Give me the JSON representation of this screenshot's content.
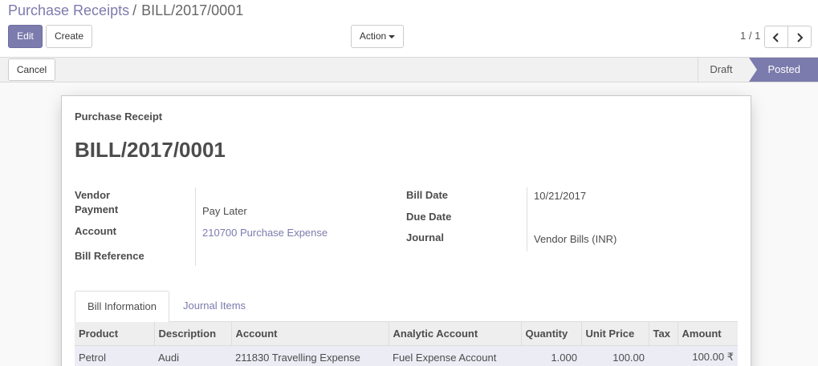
{
  "breadcrumb": {
    "parent": "Purchase Receipts",
    "separator": "/",
    "current": "BILL/2017/0001"
  },
  "toolbar": {
    "edit_label": "Edit",
    "create_label": "Create",
    "action_label": "Action"
  },
  "pager": {
    "value": "1 / 1",
    "prev_icon": "chevron-left-icon",
    "next_icon": "chevron-right-icon"
  },
  "statusbar": {
    "cancel_label": "Cancel",
    "steps": [
      {
        "label": "Draft",
        "active": false
      },
      {
        "label": "Posted",
        "active": true
      }
    ]
  },
  "form": {
    "subtitle": "Purchase Receipt",
    "title": "BILL/2017/0001",
    "left_fields": [
      {
        "label": "Vendor",
        "value": ""
      },
      {
        "label": "Payment",
        "value": "Pay Later"
      },
      {
        "label": "Account",
        "value": "210700 Purchase Expense"
      },
      {
        "label": "Bill Reference",
        "value": ""
      }
    ],
    "right_fields": [
      {
        "label": "Bill Date",
        "value": "10/21/2017"
      },
      {
        "label": "Due Date",
        "value": ""
      },
      {
        "label": "Journal",
        "value": "Vendor Bills (INR)"
      }
    ]
  },
  "tabs": [
    {
      "label": "Bill Information",
      "active": true
    },
    {
      "label": "Journal Items",
      "active": false
    }
  ],
  "table": {
    "columns": [
      "Product",
      "Description",
      "Account",
      "Analytic Account",
      "Quantity",
      "Unit Price",
      "Tax",
      "Amount"
    ],
    "rows": [
      [
        "Petrol",
        "Audi",
        "211830 Travelling Expense",
        "Fuel Expense Account",
        "1.000",
        "100.00",
        "",
        "100.00 ₹"
      ]
    ]
  },
  "colors": {
    "brand": "#7c7bad",
    "row_highlight": "#ececf5"
  }
}
